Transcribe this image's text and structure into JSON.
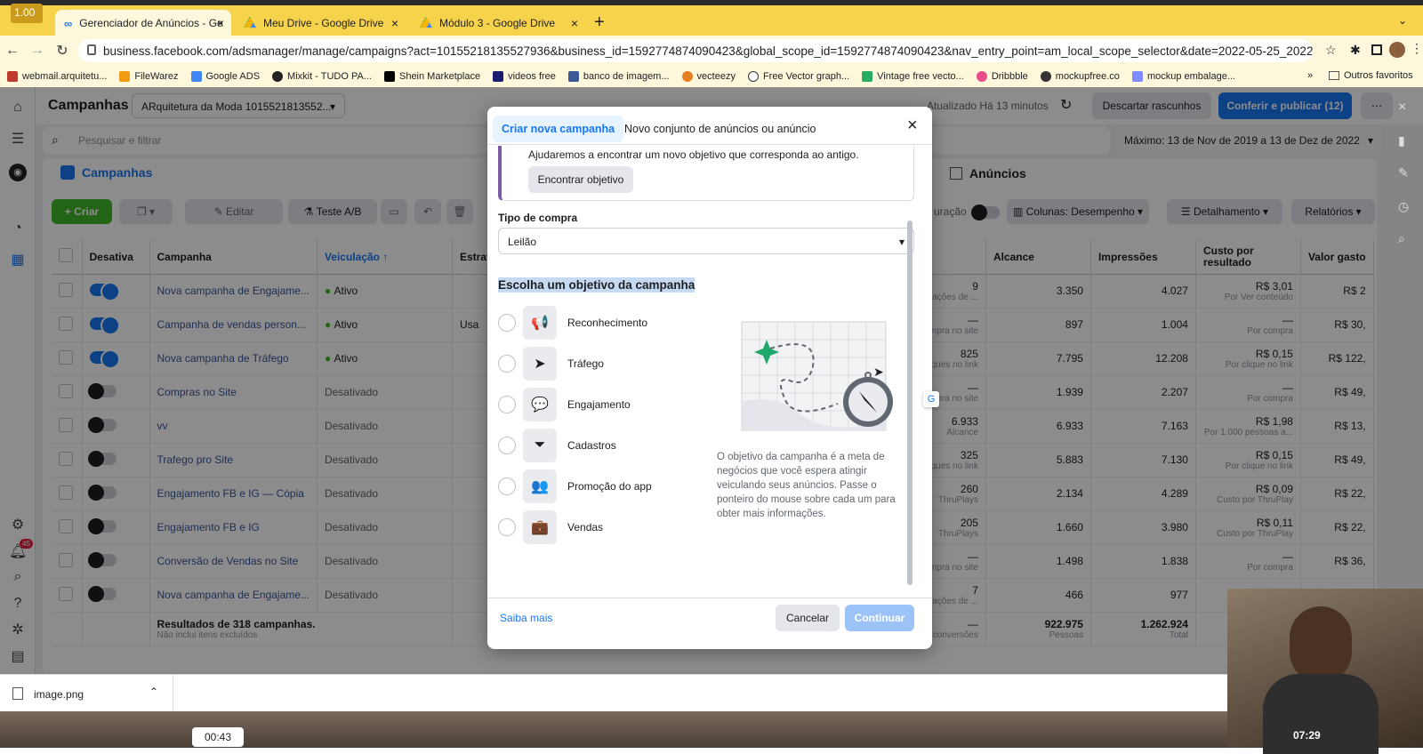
{
  "browser": {
    "badge": "1.00",
    "tabs": [
      {
        "label": "Gerenciador de Anúncios - Ge",
        "icon": "meta-icon"
      },
      {
        "label": "Meu Drive - Google Drive",
        "icon": "drive-icon"
      },
      {
        "label": "Módulo 3 - Google Drive",
        "icon": "drive-icon"
      }
    ],
    "new_tab": "+",
    "url": "business.facebook.com/adsmanager/manage/campaigns?act=10155218135527936&business_id=1592774874090423&global_scope_id=1592774874090423&nav_entry_point=am_local_scope_selector&date=2022-05-25_2022-12-13%2Cm...",
    "bookmarks": [
      "webmail.arquitetu...",
      "FileWarez",
      "Google ADS",
      "Mixkit - TUDO PA...",
      "Shein Marketplace",
      "videos free",
      "banco de imagem...",
      "vecteezy",
      "Free Vector graph...",
      "Vintage free vecto...",
      "Dribbble",
      "mockupfree.co",
      "mockup embalage..."
    ],
    "bookmarks_more": "»",
    "other_bookmarks": "Outros favoritos"
  },
  "header": {
    "title": "Campanhas",
    "account": "ARquitetura da Moda 1015521813552...",
    "updated": "Atualizado Há 13 minutos",
    "discard": "Descartar rascunhos",
    "publish": "Conferir e publicar (12)"
  },
  "search": {
    "placeholder": "Pesquisar e filtrar"
  },
  "date_filter": "Máximo: 13 de Nov de 2019 a 13 de Dez de 2022",
  "panels": {
    "campaigns": "Campanhas",
    "ads": "Anúncios"
  },
  "toolbar": {
    "create": "+ Criar",
    "edit": "Editar",
    "ab_test": "Teste A/B",
    "duration": "uração",
    "columns": "Colunas: Desempenho",
    "breakdown": "Detalhamento",
    "reports": "Relatórios"
  },
  "table": {
    "headers": [
      "Desativa",
      "Campanha",
      "Veiculação ↑",
      "Estrat",
      "sultados",
      "Alcance",
      "Impressões",
      "Custo por resultado",
      "Valor gasto"
    ],
    "rows": [
      {
        "name": "Nova campanha de Engajame...",
        "status": "Ativo",
        "on": true,
        "result": "9",
        "result_sub": "ações de ...",
        "reach": "3.350",
        "impr": "4.027",
        "cost": "R$ 3,01",
        "cost_sub": "Por Ver conteúdo",
        "spent": "R$ 2"
      },
      {
        "name": "Campanha de vendas person...",
        "status": "Ativo",
        "on": true,
        "strat": "Usa",
        "result": "—",
        "result_sub": "Compra no site",
        "reach": "897",
        "impr": "1.004",
        "cost": "—",
        "cost_sub": "Por compra",
        "spent": "R$ 30,"
      },
      {
        "name": "Nova campanha de Tráfego",
        "status": "Ativo",
        "on": true,
        "result": "825",
        "result_sub": "Cliques no link",
        "reach": "7.795",
        "impr": "12.208",
        "cost": "R$ 0,15",
        "cost_sub": "Por clique no link",
        "spent": "R$ 122,"
      },
      {
        "name": "Compras no Site",
        "status": "Desativado",
        "on": false,
        "result": "—",
        "result_sub": "mpra no site",
        "reach": "1.939",
        "impr": "2.207",
        "cost": "—",
        "cost_sub": "Por compra",
        "spent": "R$ 49,"
      },
      {
        "name": "vv",
        "status": "Desativado",
        "on": false,
        "result": "6.933",
        "result_sub": "Alcance",
        "reach": "6.933",
        "impr": "7.163",
        "cost": "R$ 1,98",
        "cost_sub": "Por 1.000 pessoas a...",
        "spent": "R$ 13,"
      },
      {
        "name": "Trafego pro Site",
        "status": "Desativado",
        "on": false,
        "result": "325",
        "result_sub": "Cliques no link",
        "reach": "5.883",
        "impr": "7.130",
        "cost": "R$ 0,15",
        "cost_sub": "Por clique no link",
        "spent": "R$ 49,"
      },
      {
        "name": "Engajamento FB e IG — Cópia",
        "status": "Desativado",
        "on": false,
        "result": "260",
        "result_sub": "ThruPlays",
        "reach": "2.134",
        "impr": "4.289",
        "cost": "R$ 0,09",
        "cost_sub": "Custo por ThruPlay",
        "spent": "R$ 22,"
      },
      {
        "name": "Engajamento FB e IG",
        "status": "Desativado",
        "on": false,
        "result": "205",
        "result_sub": "ThruPlays",
        "reach": "1.660",
        "impr": "3.980",
        "cost": "R$ 0,11",
        "cost_sub": "Custo por ThruPlay",
        "spent": "R$ 22,"
      },
      {
        "name": "Conversão de Vendas no Site",
        "status": "Desativado",
        "on": false,
        "result": "—",
        "result_sub": "Compra no site",
        "reach": "1.498",
        "impr": "1.838",
        "cost": "—",
        "cost_sub": "Por compra",
        "spent": "R$ 36,"
      },
      {
        "name": "Nova campanha de Engajame...",
        "status": "Desativado",
        "on": false,
        "result": "7",
        "result_sub": "ações de ...",
        "reach": "466",
        "impr": "977",
        "cost": "",
        "cost_sub": "",
        "spent": ""
      }
    ],
    "total_label": "Resultados de 318 campanhas.",
    "total_sub": "Não inclui itens excluídos",
    "total_result": "—",
    "total_result_sub": "Várias conversões",
    "total_reach": "922.975",
    "total_reach_sub": "Pessoas",
    "total_impr": "1.262.924",
    "total_impr_sub": "Total"
  },
  "modal": {
    "tab_new": "Criar nova campanha",
    "tab_existing": "Novo conjunto de anúncios ou anúncio",
    "notice": "Ajudaremos a encontrar um novo objetivo que corresponda ao antigo.",
    "find_objective": "Encontrar objetivo",
    "purchase_type_label": "Tipo de compra",
    "purchase_type": "Leilão",
    "objective_heading": "Escolha um objetivo da campanha",
    "objectives": [
      {
        "label": "Reconhecimento",
        "icon": "megaphone-icon",
        "glyph": "📢"
      },
      {
        "label": "Tráfego",
        "icon": "cursor-icon",
        "glyph": "➤"
      },
      {
        "label": "Engajamento",
        "icon": "chat-icon",
        "glyph": "💬"
      },
      {
        "label": "Cadastros",
        "icon": "funnel-icon",
        "glyph": "⏷"
      },
      {
        "label": "Promoção do app",
        "icon": "people-icon",
        "glyph": "👥"
      },
      {
        "label": "Vendas",
        "icon": "briefcase-icon",
        "glyph": "💼"
      }
    ],
    "description": "O objetivo da campanha é a meta de negócios que você espera atingir veiculando seus anúncios. Passe o ponteiro do mouse sobre cada um para obter mais informações.",
    "learn_more": "Saiba mais",
    "cancel": "Cancelar",
    "continue": "Continuar"
  },
  "download": {
    "file": "image.png"
  },
  "video": {
    "elapsed": "00:43",
    "remaining": "07:29"
  },
  "colors": {
    "accent": "#1877f2",
    "link": "#385898",
    "tab_bar": "#f6d34a"
  }
}
